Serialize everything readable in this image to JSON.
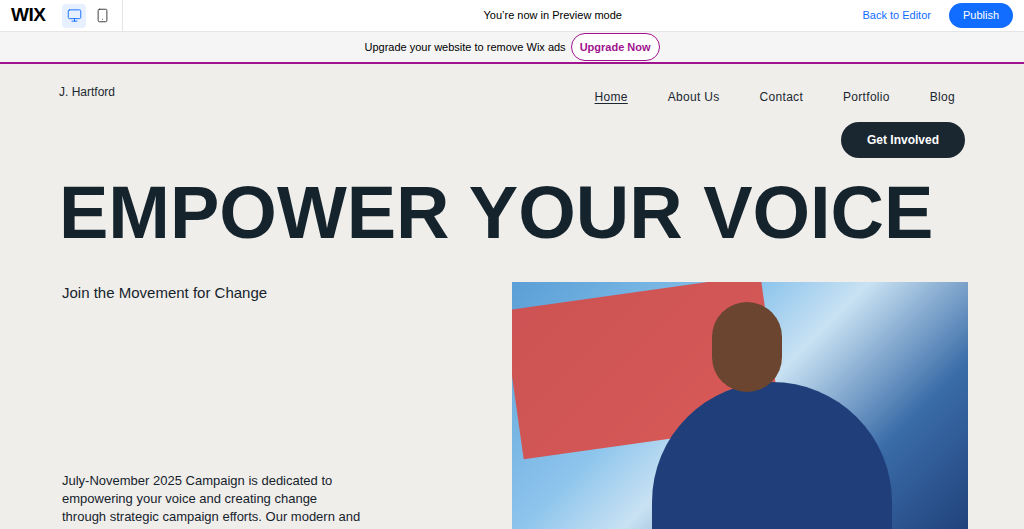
{
  "wix_bar": {
    "logo": "WIX",
    "devices": [
      {
        "kind": "desktop",
        "selected": true
      },
      {
        "kind": "mobile",
        "selected": false
      }
    ],
    "status": "You’re now in Preview mode",
    "back_link": "Back to Editor",
    "publish_button": "Publish"
  },
  "ad_bar": {
    "text": "Upgrade your website to remove Wix ads",
    "button": "Upgrade Now"
  },
  "site": {
    "logo": "J. Hartford",
    "nav": [
      {
        "label": "Home",
        "selected": true
      },
      {
        "label": "About Us",
        "selected": false
      },
      {
        "label": "Contact",
        "selected": false
      },
      {
        "label": "Portfolio",
        "selected": false
      },
      {
        "label": "Blog",
        "selected": false
      }
    ],
    "cta_button": "Get Involved",
    "headline": "EMPOWER YOUR VOICE",
    "subtitle": "Join the Movement for Change",
    "paragraph_lines": [
      "July-November 2025 Campaign is dedicated to",
      "empowering your voice and creating change",
      "through strategic campaign efforts. Our modern and"
    ]
  }
}
